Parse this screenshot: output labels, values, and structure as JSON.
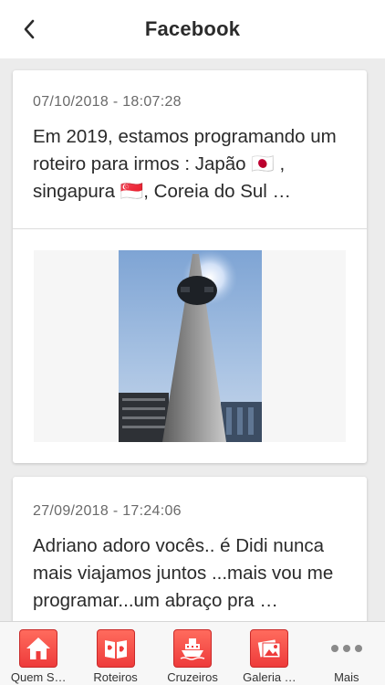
{
  "header": {
    "title": "Facebook"
  },
  "posts": [
    {
      "date": "07/10/2018 - 18:07:28",
      "message": "Em 2019, estamos programando um roteiro para irmos : Japão 🇯🇵 , singapura 🇸🇬, Coreia do Sul …",
      "image": "obelisk-monument-photo"
    },
    {
      "date": "27/09/2018 - 17:24:06",
      "message": "Adriano adoro vocês.. é Didi nunca mais viajamos juntos ...mais vou me programar...um abraço pra …"
    }
  ],
  "tabbar": {
    "items": [
      {
        "label": "Quem S…",
        "icon": "home-icon"
      },
      {
        "label": "Roteiros",
        "icon": "map-book-icon"
      },
      {
        "label": "Cruzeiros",
        "icon": "ship-icon"
      },
      {
        "label": "Galeria …",
        "icon": "gallery-icon"
      },
      {
        "label": "Mais",
        "icon": "more-icon"
      }
    ]
  },
  "colors": {
    "accent": "#ee3b3b",
    "background": "#ececec"
  }
}
